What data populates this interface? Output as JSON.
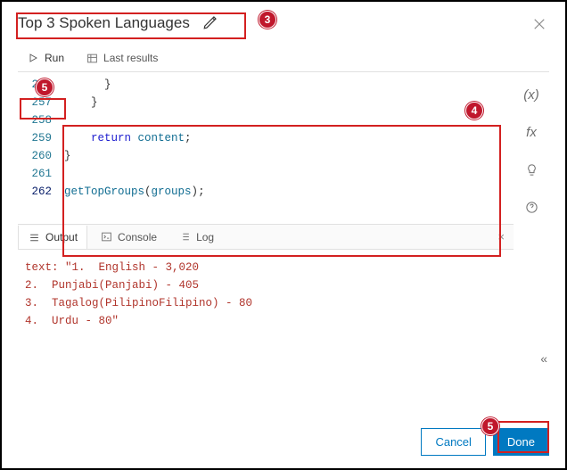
{
  "header": {
    "title": "Top 3 Spoken Languages"
  },
  "toolbar": {
    "run_label": "Run",
    "last_results_label": "Last results"
  },
  "code": {
    "lines": [
      {
        "n": "256",
        "indent": 3,
        "tokens": [
          "}"
        ]
      },
      {
        "n": "257",
        "indent": 2,
        "tokens": [
          "}"
        ]
      },
      {
        "n": "258",
        "indent": 0,
        "tokens": []
      },
      {
        "n": "259",
        "indent": 2,
        "tokens": [
          "return ",
          "content",
          ";"
        ]
      },
      {
        "n": "260",
        "indent": 0,
        "tokens": [
          "}"
        ]
      },
      {
        "n": "261",
        "indent": 0,
        "tokens": []
      },
      {
        "n": "262",
        "indent": 0,
        "tokens": [
          "getTopGroups",
          "(",
          "groups",
          ")",
          ";"
        ]
      }
    ]
  },
  "sidebar": {
    "vars": "(x)",
    "fx": "fx"
  },
  "output_tabs": {
    "output": "Output",
    "console": "Console",
    "log": "Log"
  },
  "output": {
    "prefix": "text:",
    "lines": [
      "\"1.  English - 3,020",
      "2.  Punjabi(Panjabi) - 405",
      "3.  Tagalog(PilipinoFilipino) - 80",
      "4.  Urdu - 80\""
    ]
  },
  "footer": {
    "cancel": "Cancel",
    "done": "Done"
  },
  "annotations": {
    "b3": "3",
    "b4": "4",
    "b5a": "5",
    "b5b": "5"
  }
}
